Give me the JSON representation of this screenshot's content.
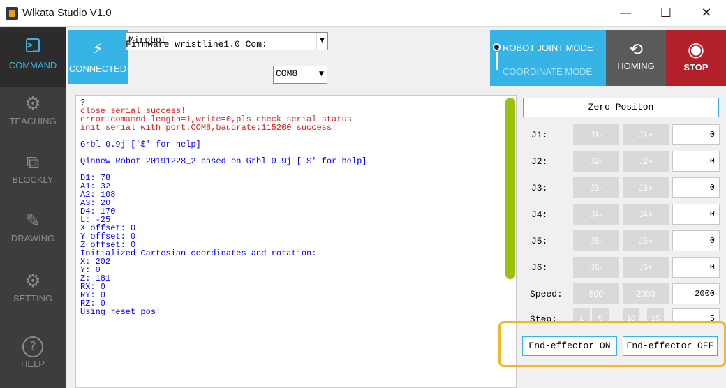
{
  "window": {
    "title": "Wlkata Studio V1.0",
    "minimize": "—",
    "maximize": "☐",
    "close": "✕"
  },
  "sidebar": {
    "items": [
      {
        "label": "COMMAND",
        "icon": ">_"
      },
      {
        "label": "TEACHING",
        "icon": "⚙"
      },
      {
        "label": "BLOCKLY",
        "icon": "⧉"
      },
      {
        "label": "DRAWING",
        "icon": "✎"
      },
      {
        "label": "SETTING",
        "icon": "⚙"
      },
      {
        "label": "HELP",
        "icon": "?"
      }
    ]
  },
  "topbar": {
    "connected_label": "CONNECTED",
    "device_select": "Mirobot",
    "firmware_label": "Firmware wristline1.0 Com:",
    "com_select": "COM8",
    "mode_joint": "ROBOT JOINT MODE",
    "mode_coord": "COORDINATE MODE",
    "homing_label": "HOMING",
    "stop_label": "STOP"
  },
  "console": {
    "lines": [
      {
        "text": "?",
        "color": "#222222"
      },
      {
        "text": "close serial success!",
        "color": "#e02020"
      },
      {
        "text": "error:comamnd length=1,write=0,pls check serial status",
        "color": "#e02020"
      },
      {
        "text": "init serial with port:COM8,baudrate:115200 success!",
        "color": "#e02020"
      },
      {
        "text": "",
        "color": "#0000ff"
      },
      {
        "text": "Grbl 0.9j ['$' for help]",
        "color": "#0000ff"
      },
      {
        "text": "",
        "color": "#0000ff"
      },
      {
        "text": "Qinnew Robot 20191228_2 based on Grbl 0.9j ['$' for help]",
        "color": "#0000ff"
      },
      {
        "text": "",
        "color": "#0000ff"
      },
      {
        "text": "D1: 78",
        "color": "#0000ff"
      },
      {
        "text": "A1: 32",
        "color": "#0000ff"
      },
      {
        "text": "A2: 108",
        "color": "#0000ff"
      },
      {
        "text": "A3: 20",
        "color": "#0000ff"
      },
      {
        "text": "D4: 170",
        "color": "#0000ff"
      },
      {
        "text": "L: -25",
        "color": "#0000ff"
      },
      {
        "text": "X offset: 0",
        "color": "#0000ff"
      },
      {
        "text": "Y offset: 0",
        "color": "#0000ff"
      },
      {
        "text": "Z offset: 0",
        "color": "#0000ff"
      },
      {
        "text": "Initialized Cartesian coordinates and rotation:",
        "color": "#0000ff"
      },
      {
        "text": "X: 202",
        "color": "#0000ff"
      },
      {
        "text": "Y: 0",
        "color": "#0000ff"
      },
      {
        "text": "Z: 181",
        "color": "#0000ff"
      },
      {
        "text": "RX: 0",
        "color": "#0000ff"
      },
      {
        "text": "RY: 0",
        "color": "#0000ff"
      },
      {
        "text": "RZ: 0",
        "color": "#0000ff"
      },
      {
        "text": "Using reset pos!",
        "color": "#0000ff"
      }
    ]
  },
  "panel": {
    "zero_position": "Zero Positon",
    "joints": [
      {
        "label": "J1:",
        "minus": "J1-",
        "plus": "J1+",
        "value": "0"
      },
      {
        "label": "J2:",
        "minus": "J2-",
        "plus": "J2+",
        "value": "0"
      },
      {
        "label": "J3:",
        "minus": "J3-",
        "plus": "J3+",
        "value": "0"
      },
      {
        "label": "J4:",
        "minus": "J4-",
        "plus": "J4+",
        "value": "0"
      },
      {
        "label": "J5:",
        "minus": "J5-",
        "plus": "J5+",
        "value": "0"
      },
      {
        "label": "J6:",
        "minus": "J6-",
        "plus": "J6+",
        "value": "0"
      }
    ],
    "speed": {
      "label": "Speed:",
      "opt1": "500",
      "opt2": "2000",
      "value": "2000"
    },
    "step": {
      "label": "Step:",
      "opts": [
        "1",
        "5",
        "10",
        "15"
      ],
      "value": "5"
    },
    "end_effector_on": "End-effector ON",
    "end_effector_off": "End-effector OFF"
  },
  "colors": {
    "accent": "#36b4e5",
    "stop": "#b2202a",
    "scrollbar": "#9cc20e",
    "highlight": "#f5b623"
  }
}
